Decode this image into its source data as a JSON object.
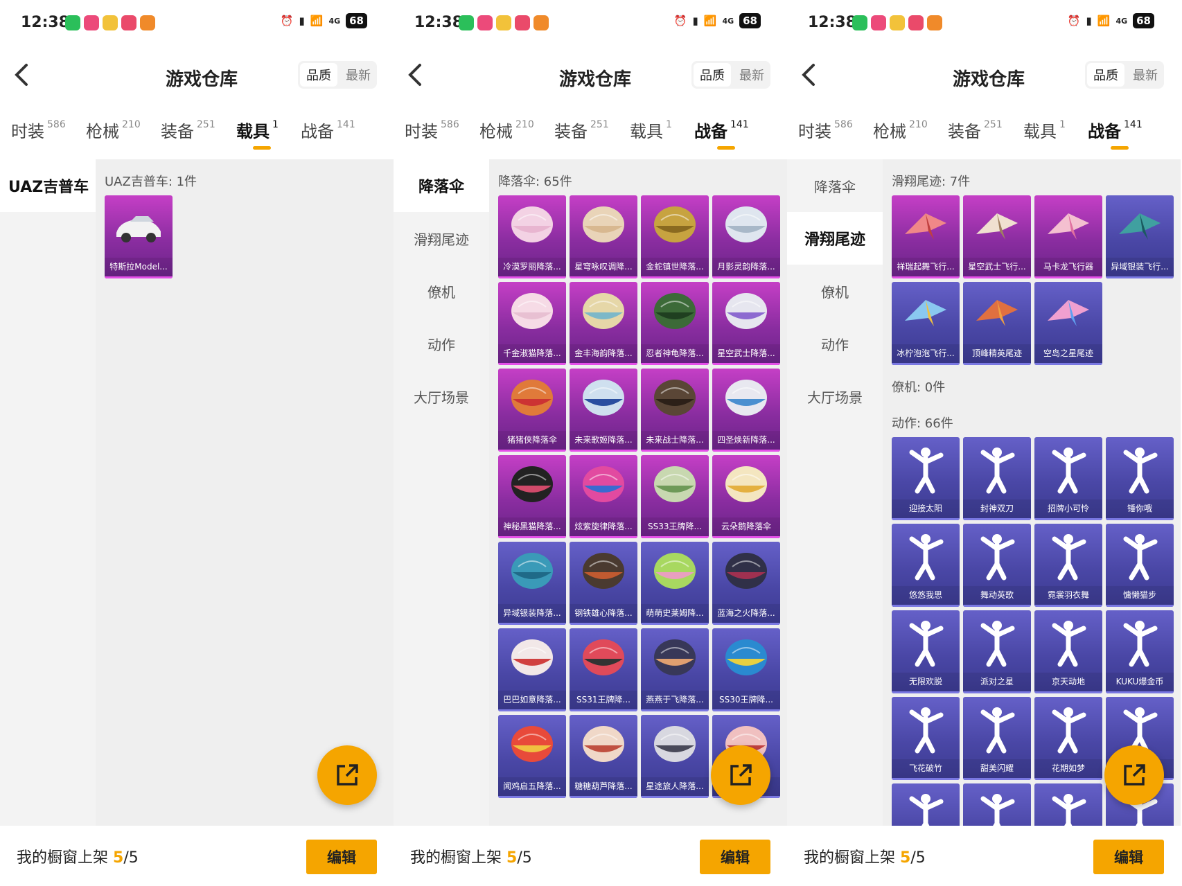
{
  "status_bar": {
    "time": "12:38",
    "signal": "4G",
    "battery": "68"
  },
  "header": {
    "title": "游戏仓库",
    "sort_quality": "品质",
    "sort_latest": "最新"
  },
  "tabs": [
    {
      "label": "时装",
      "count": "586"
    },
    {
      "label": "枪械",
      "count": "210"
    },
    {
      "label": "装备",
      "count": "251"
    },
    {
      "label": "载具",
      "count": "1"
    },
    {
      "label": "战备",
      "count": "141"
    }
  ],
  "footer": {
    "text": "我的橱窗上架",
    "current": "5",
    "total": "/5",
    "edit_label": "编辑"
  },
  "panels": [
    {
      "active_tab": 3,
      "side_items": [
        {
          "label": "UAZ吉普车",
          "active": true
        }
      ],
      "sections": [
        {
          "title": "UAZ吉普车: 1件",
          "tone": "purple",
          "items": [
            "特斯拉Model..."
          ]
        }
      ]
    },
    {
      "active_tab": 4,
      "side_items": [
        {
          "label": "降落伞",
          "active": true
        },
        {
          "label": "滑翔尾迹",
          "active": false
        },
        {
          "label": "僚机",
          "active": false
        },
        {
          "label": "动作",
          "active": false
        },
        {
          "label": "大厅场景",
          "active": false
        }
      ],
      "sections": [
        {
          "title": "降落伞: 65件",
          "tone": "mixed",
          "items": [
            "冷漠罗丽降落...",
            "星穹咏叹调降...",
            "金蛇镇世降落...",
            "月影灵韵降落...",
            "千金淑猫降落...",
            "金丰海韵降落...",
            "忍者神龟降落...",
            "星空武士降落...",
            "猪猪侠降落伞",
            "未来歌姬降落...",
            "未来战士降落...",
            "四圣焕新降落...",
            "神秘黑猫降落...",
            "炫紫旋律降落...",
            "SS33王牌降...",
            "云朵鹅降落伞",
            "异域银装降落...",
            "钢铁雄心降落...",
            "萌萌史莱姆降...",
            "蓝海之火降落...",
            "巴巴如意降落...",
            "SS31王牌降...",
            "燕燕于飞降落...",
            "SS30王牌降...",
            "闻鸡启五降落...",
            "糖糖葫芦降落...",
            "星途旅人降落...",
            "..."
          ]
        }
      ]
    },
    {
      "active_tab": 4,
      "side_items": [
        {
          "label": "降落伞",
          "active": false
        },
        {
          "label": "滑翔尾迹",
          "active": true
        },
        {
          "label": "僚机",
          "active": false
        },
        {
          "label": "动作",
          "active": false
        },
        {
          "label": "大厅场景",
          "active": false
        }
      ],
      "sections": [
        {
          "title": "滑翔尾迹: 7件",
          "tone": "mixed",
          "items": [
            "祥瑞起舞飞行...",
            "星空武士飞行...",
            "马卡龙飞行器",
            "异域银装飞行...",
            "冰柠泡泡飞行...",
            "顶峰精英尾迹",
            "空岛之星尾迹"
          ]
        },
        {
          "title": "僚机: 0件",
          "tone": "blue",
          "items": []
        },
        {
          "title": "动作: 66件",
          "tone": "blue",
          "items": [
            "迎接太阳",
            "封神双刀",
            "招牌小可怜",
            "锤你哦",
            "悠悠我思",
            "舞动英歌",
            "霓裳羽衣舞",
            "慵懒猫步",
            "无限欢脱",
            "派对之星",
            "京天动地",
            "KUKU爆金币",
            "飞花破竹",
            "甜美闪耀",
            "花期如梦",
            "",
            "",
            "",
            "",
            ""
          ]
        }
      ]
    }
  ],
  "colors": {
    "accent": "#f5a500",
    "card_purple": "#a534b4",
    "card_blue": "#4b49a8"
  }
}
